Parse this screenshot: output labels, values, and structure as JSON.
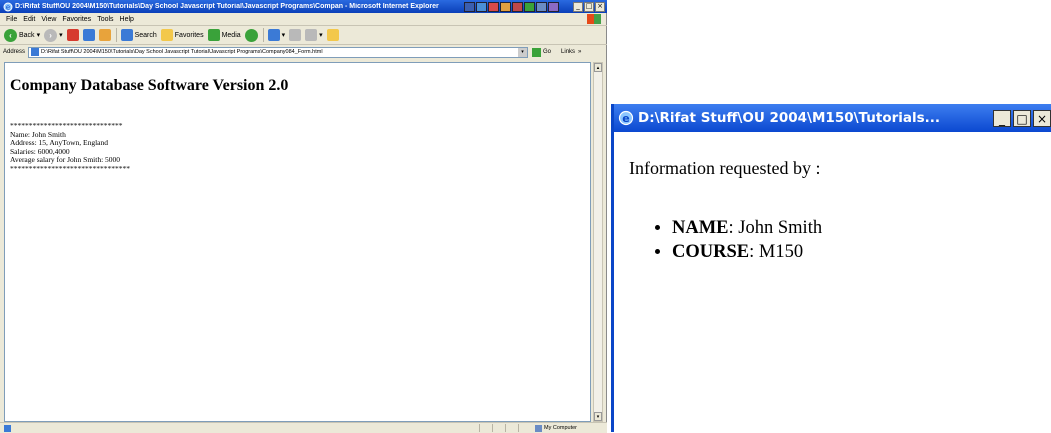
{
  "ie": {
    "title": "D:\\Rifat Stuff\\OU 2004\\M150\\Tutorials\\Day School Javascript Tutorial\\Javascript Programs\\Compan - Microsoft Internet Explorer",
    "menu": [
      "File",
      "Edit",
      "View",
      "Favorites",
      "Tools",
      "Help"
    ],
    "toolbar": {
      "back": "Back",
      "search": "Search",
      "favorites": "Favorites",
      "media": "Media"
    },
    "address": {
      "label": "Address",
      "url": "D:\\Rifat Stuff\\OU 2004\\M150\\Tutorials\\Day School Javascript Tutorial\\Javascript Programs\\Company084_Form.html",
      "go": "Go",
      "links": "Links"
    },
    "heading": "Company Database Software Version 2.0",
    "lines": [
      "******************************",
      "Name: John Smith",
      "Address: 15, AnyTown, England",
      "Salaries: 6000,4000",
      "Average salary for John Smith: 5000",
      "********************************"
    ],
    "status": {
      "zone": "My Computer"
    }
  },
  "popup": {
    "title": "D:\\Rifat Stuff\\OU 2004\\M150\\Tutorials...",
    "intro": "Information requested by :",
    "items": [
      {
        "label": "NAME",
        "value": ": John Smith"
      },
      {
        "label": "COURSE",
        "value": ": M150"
      }
    ]
  },
  "colors": {
    "titlebar": "#0a46c8",
    "window": "#ece9d8"
  }
}
